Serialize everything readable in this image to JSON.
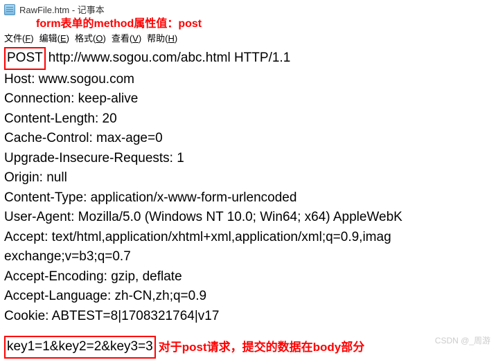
{
  "window": {
    "title": "RawFile.htm - 记事本"
  },
  "annotations": {
    "method": "form表单的method属性值：post",
    "body": "对于post请求，提交的数据在body部分"
  },
  "menu": {
    "file": "文件(F)",
    "edit": "编辑(E)",
    "format": "格式(O)",
    "view": "查看(V)",
    "help": "帮助(H)"
  },
  "content": {
    "method": "POST",
    "url": " http://www.sogou.com/abc.html HTTP/1.1",
    "lines": [
      "Host: www.sogou.com",
      "Connection: keep-alive",
      "Content-Length: 20",
      "Cache-Control: max-age=0",
      "Upgrade-Insecure-Requests: 1",
      "Origin: null",
      "Content-Type: application/x-www-form-urlencoded",
      "User-Agent: Mozilla/5.0 (Windows NT 10.0; Win64; x64) AppleWebK",
      "Accept: text/html,application/xhtml+xml,application/xml;q=0.9,imag",
      "exchange;v=b3;q=0.7",
      "Accept-Encoding: gzip, deflate",
      "Accept-Language: zh-CN,zh;q=0.9",
      "Cookie: ABTEST=8|1708321764|v17"
    ],
    "body": "key1=1&key2=2&key3=3"
  },
  "watermark": "CSDN @_周游"
}
